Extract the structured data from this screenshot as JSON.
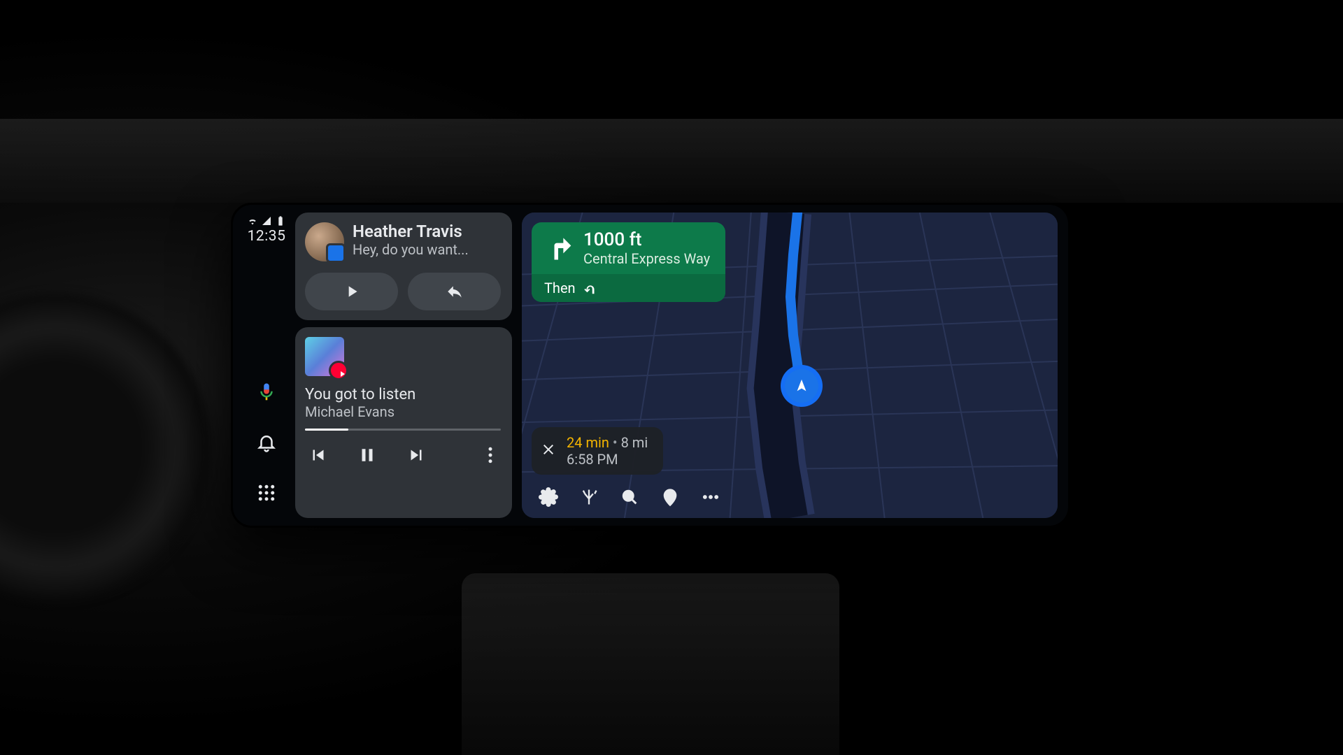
{
  "status": {
    "time": "12:35"
  },
  "message": {
    "sender": "Heather Travis",
    "preview": "Hey, do you want..."
  },
  "media": {
    "track": "You got to listen",
    "artist": "Michael Evans"
  },
  "nav": {
    "distance": "1000 ft",
    "road": "Central Express Way",
    "then_label": "Then"
  },
  "eta": {
    "duration": "24 min",
    "distance": "8 mi",
    "arrival": "6:58 PM"
  }
}
